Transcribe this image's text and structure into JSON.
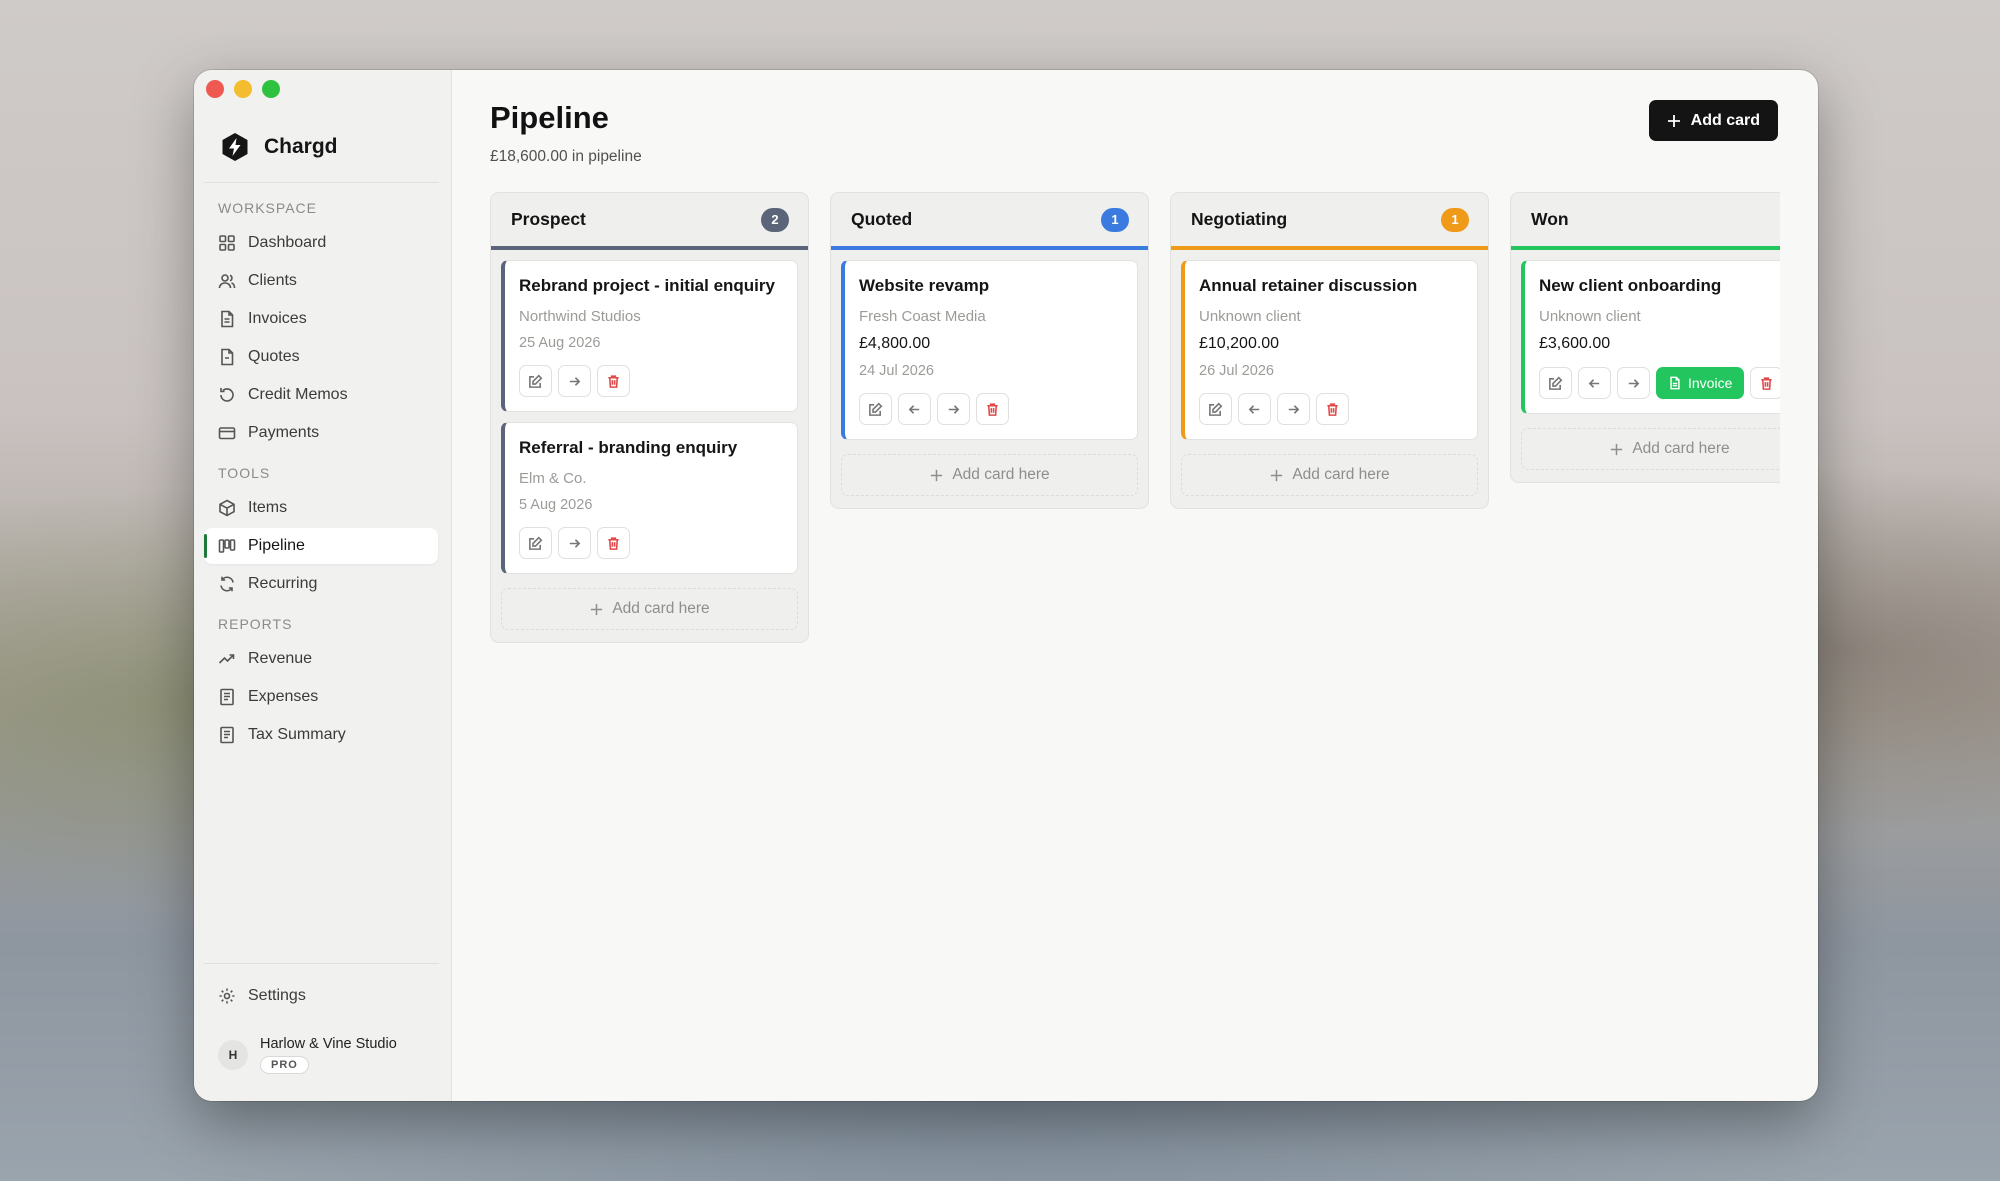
{
  "app": {
    "name": "Chargd"
  },
  "sidebar": {
    "sections": [
      {
        "label": "WORKSPACE"
      },
      {
        "label": "TOOLS"
      },
      {
        "label": "REPORTS"
      }
    ],
    "items": [
      {
        "label": "Dashboard",
        "icon": "dashboard-icon"
      },
      {
        "label": "Clients",
        "icon": "users-icon"
      },
      {
        "label": "Invoices",
        "icon": "document-icon"
      },
      {
        "label": "Quotes",
        "icon": "quote-document-icon"
      },
      {
        "label": "Credit Memos",
        "icon": "undo-icon"
      },
      {
        "label": "Payments",
        "icon": "credit-card-icon"
      },
      {
        "label": "Items",
        "icon": "box-icon"
      },
      {
        "label": "Pipeline",
        "icon": "pipeline-icon",
        "active": true
      },
      {
        "label": "Recurring",
        "icon": "refresh-icon"
      },
      {
        "label": "Revenue",
        "icon": "trending-up-icon"
      },
      {
        "label": "Expenses",
        "icon": "receipt-icon"
      },
      {
        "label": "Tax Summary",
        "icon": "receipt-icon"
      }
    ],
    "settings_label": "Settings",
    "user": {
      "initial": "H",
      "name": "Harlow & Vine Studio",
      "plan": "PRO"
    }
  },
  "header": {
    "title": "Pipeline",
    "subtitle": "£18,600.00 in pipeline",
    "add_button": "Add card"
  },
  "columns": [
    {
      "title": "Prospect",
      "count": "2",
      "color": "#5b6478",
      "cards": [
        {
          "title": "Rebrand project - initial enquiry",
          "client": "Northwind Studios",
          "amount": "",
          "date": "25 Aug 2026"
        },
        {
          "title": "Referral - branding enquiry",
          "client": "Elm & Co.",
          "amount": "",
          "date": "5 Aug 2026"
        }
      ]
    },
    {
      "title": "Quoted",
      "count": "1",
      "color": "#3b7be0",
      "cards": [
        {
          "title": "Website revamp",
          "client": "Fresh Coast Media",
          "amount": "£4,800.00",
          "date": "24 Jul 2026"
        }
      ]
    },
    {
      "title": "Negotiating",
      "count": "1",
      "color": "#f09a1a",
      "cards": [
        {
          "title": "Annual retainer discussion",
          "client": "Unknown client",
          "amount": "£10,200.00",
          "date": "26 Jul 2026"
        }
      ]
    },
    {
      "title": "Won",
      "count": "",
      "color": "#22c55e",
      "cards": [
        {
          "title": "New client onboarding",
          "client": "Unknown client",
          "amount": "£3,600.00",
          "date": ""
        }
      ]
    }
  ],
  "add_card_here_label": "Add card here",
  "invoice_label": "Invoice"
}
